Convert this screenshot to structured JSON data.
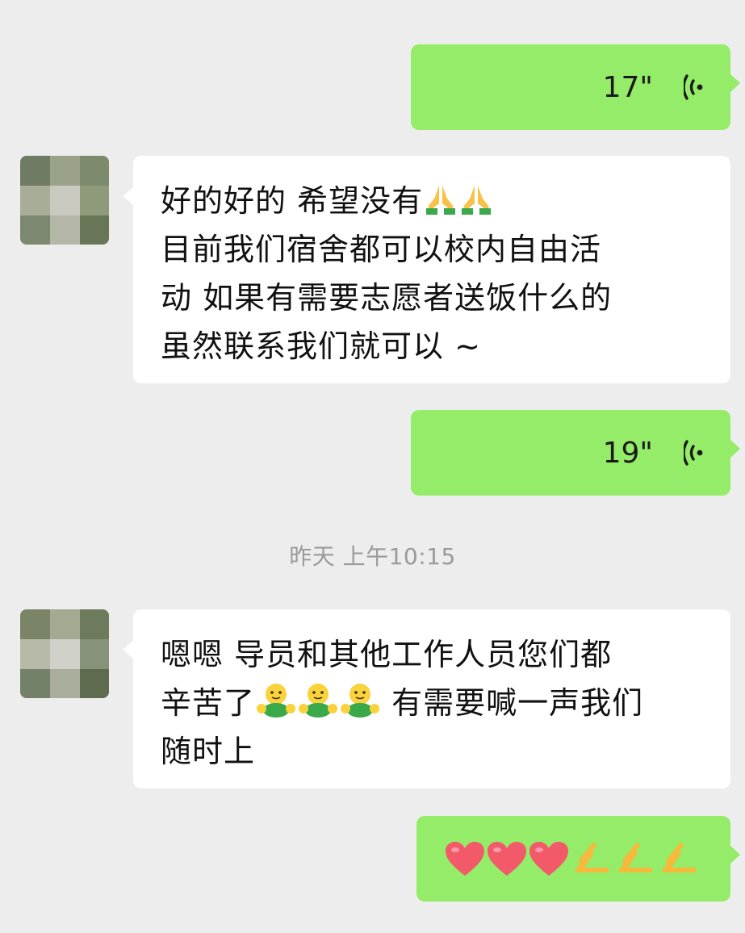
{
  "messages": [
    {
      "side": "out",
      "type": "voice",
      "duration": "17\""
    },
    {
      "side": "in",
      "type": "text",
      "lines": [
        "好的好的 希望没有",
        "目前我们宿舍都可以校内自由活",
        "动 如果有需要志愿者送饭什么的",
        "虽然联系我们就可以 ~"
      ],
      "emoji": [
        "pray-icon",
        "pray-icon"
      ]
    },
    {
      "side": "out",
      "type": "voice",
      "duration": "19\""
    },
    {
      "side": "in",
      "type": "text",
      "lines": [
        "嗯嗯 导员和其他工作人员您们都",
        "辛苦了",
        "有需要喊一声我们",
        "随时上"
      ],
      "emoji": [
        "hugging-face-icon",
        "hugging-face-icon",
        "hugging-face-icon"
      ]
    },
    {
      "side": "out",
      "type": "emoji",
      "emoji": [
        "heart-icon",
        "heart-icon",
        "heart-icon",
        "clap-icon",
        "clap-icon",
        "clap-icon"
      ]
    }
  ],
  "timestamp": "昨天 上午10:15",
  "colors": {
    "background": "#ededed",
    "outgoing": "#95ec69",
    "incoming": "#ffffff",
    "timestamp": "#9a9a9a"
  }
}
